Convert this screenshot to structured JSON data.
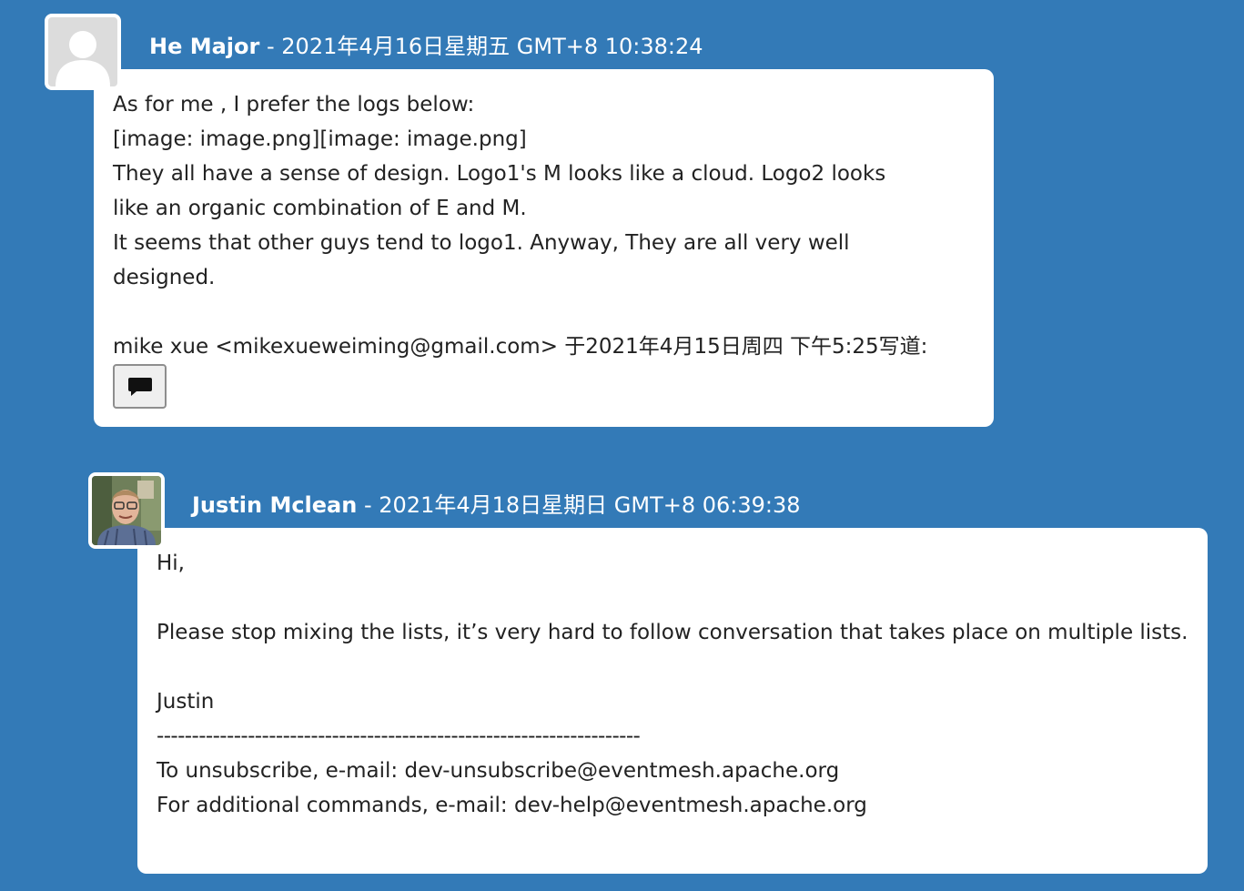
{
  "messages": [
    {
      "author": "He Major",
      "separator": " - ",
      "date": "2021年4月16日星期五 GMT+8 10:38:24",
      "avatar_icon": "default-user-icon",
      "body_lines": [
        "As for me , I prefer the logs below:",
        "[image: image.png][image: image.png]",
        "They all have a sense of design. Logo1's M looks like a cloud. Logo2 looks",
        "like an organic combination of E and M.",
        "It seems that other guys tend to logo1. Anyway, They are all very well",
        "designed.",
        "",
        "mike xue <mikexueweiming@gmail.com> 于2021年4月15日周四 下午5:25写道:"
      ],
      "quote_button_icon": "speech-bubble-icon"
    },
    {
      "author": "Justin Mclean",
      "separator": " - ",
      "date": "2021年4月18日星期日 GMT+8 06:39:38",
      "avatar_icon": "user-photo",
      "body_lines": [
        "Hi,",
        "",
        "Please stop mixing the lists, it’s very hard to follow conversation that takes place on multiple lists.",
        "",
        "Justin",
        "---------------------------------------------------------------------",
        "To unsubscribe, e-mail: dev-unsubscribe@eventmesh.apache.org",
        "For additional commands, e-mail: dev-help@eventmesh.apache.org"
      ]
    }
  ],
  "colors": {
    "background": "#337ab7",
    "bubble": "#ffffff",
    "text": "#222222"
  }
}
